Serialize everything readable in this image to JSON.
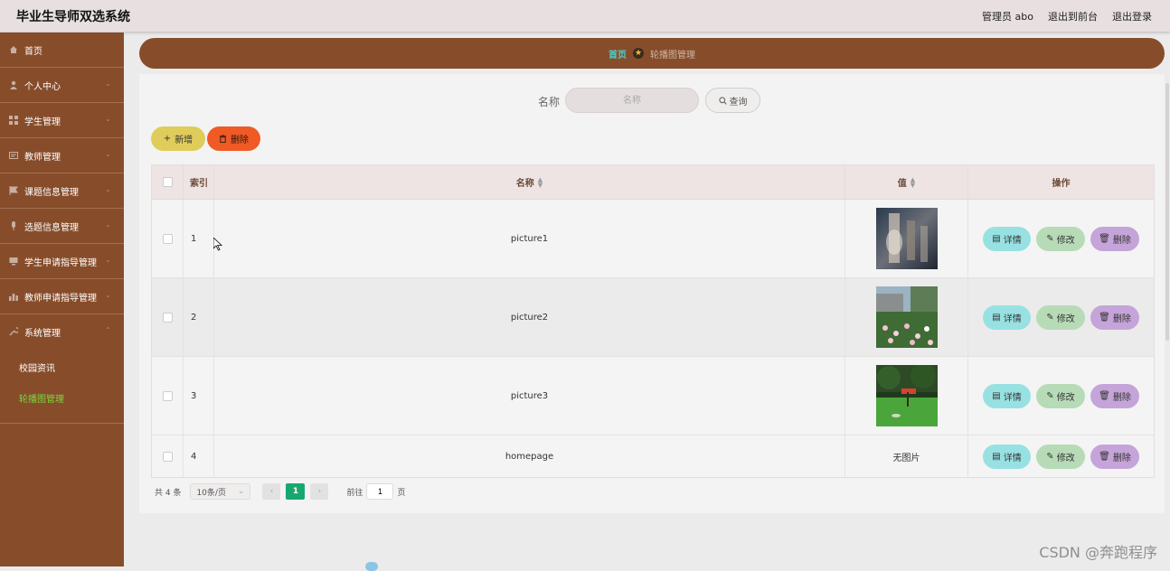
{
  "app": {
    "title": "毕业生导师双选系统",
    "user_label": "管理员 abo",
    "to_front": "退出到前台",
    "logout": "退出登录"
  },
  "sidebar": {
    "items": [
      {
        "label": "首页",
        "icon": "home-icon"
      },
      {
        "label": "个人中心",
        "icon": "user-icon"
      },
      {
        "label": "学生管理",
        "icon": "grid-icon"
      },
      {
        "label": "教师管理",
        "icon": "card-icon"
      },
      {
        "label": "课题信息管理",
        "icon": "flag-icon"
      },
      {
        "label": "选题信息管理",
        "icon": "mic-icon"
      },
      {
        "label": "学生申请指导管理",
        "icon": "monitor-icon"
      },
      {
        "label": "教师申请指导管理",
        "icon": "bar-chart-icon"
      },
      {
        "label": "系统管理",
        "icon": "wrench-icon"
      }
    ],
    "sub_items": [
      {
        "label": "校园资讯",
        "active": false
      },
      {
        "label": "轮播图管理",
        "active": true
      }
    ]
  },
  "breadcrumb": {
    "home": "首页",
    "current": "轮播图管理"
  },
  "search": {
    "label": "名称",
    "placeholder": "名称",
    "button": "查询"
  },
  "actions": {
    "add": "新增",
    "delete": "删除"
  },
  "table": {
    "headers": {
      "index": "索引",
      "name": "名称",
      "value": "值",
      "ops": "操作"
    },
    "rows": [
      {
        "index": "1",
        "name": "picture1",
        "value": "image",
        "thumb": "blur"
      },
      {
        "index": "2",
        "name": "picture2",
        "value": "image",
        "thumb": "garden"
      },
      {
        "index": "3",
        "name": "picture3",
        "value": "image",
        "thumb": "park"
      },
      {
        "index": "4",
        "name": "homepage",
        "value": "无图片"
      }
    ],
    "row_buttons": {
      "detail": "详情",
      "edit": "修改",
      "delete": "删除"
    }
  },
  "pagination": {
    "total": "共 4 条",
    "page_size": "10条/页",
    "current_page": "1",
    "goto_label": "前往",
    "goto_value": "1",
    "page_suffix": "页"
  },
  "watermark": "CSDN @奔跑程序",
  "colors": {
    "sidebar_bg": "#874d2b",
    "add_btn": "#e0cc5a",
    "del_btn": "#ef5a25",
    "detail_btn": "#98e1e2",
    "edit_btn": "#b7dbb6",
    "row_del_btn": "#c5a4d9",
    "page_active": "#19a770",
    "submenu_active": "#7bd63b"
  }
}
